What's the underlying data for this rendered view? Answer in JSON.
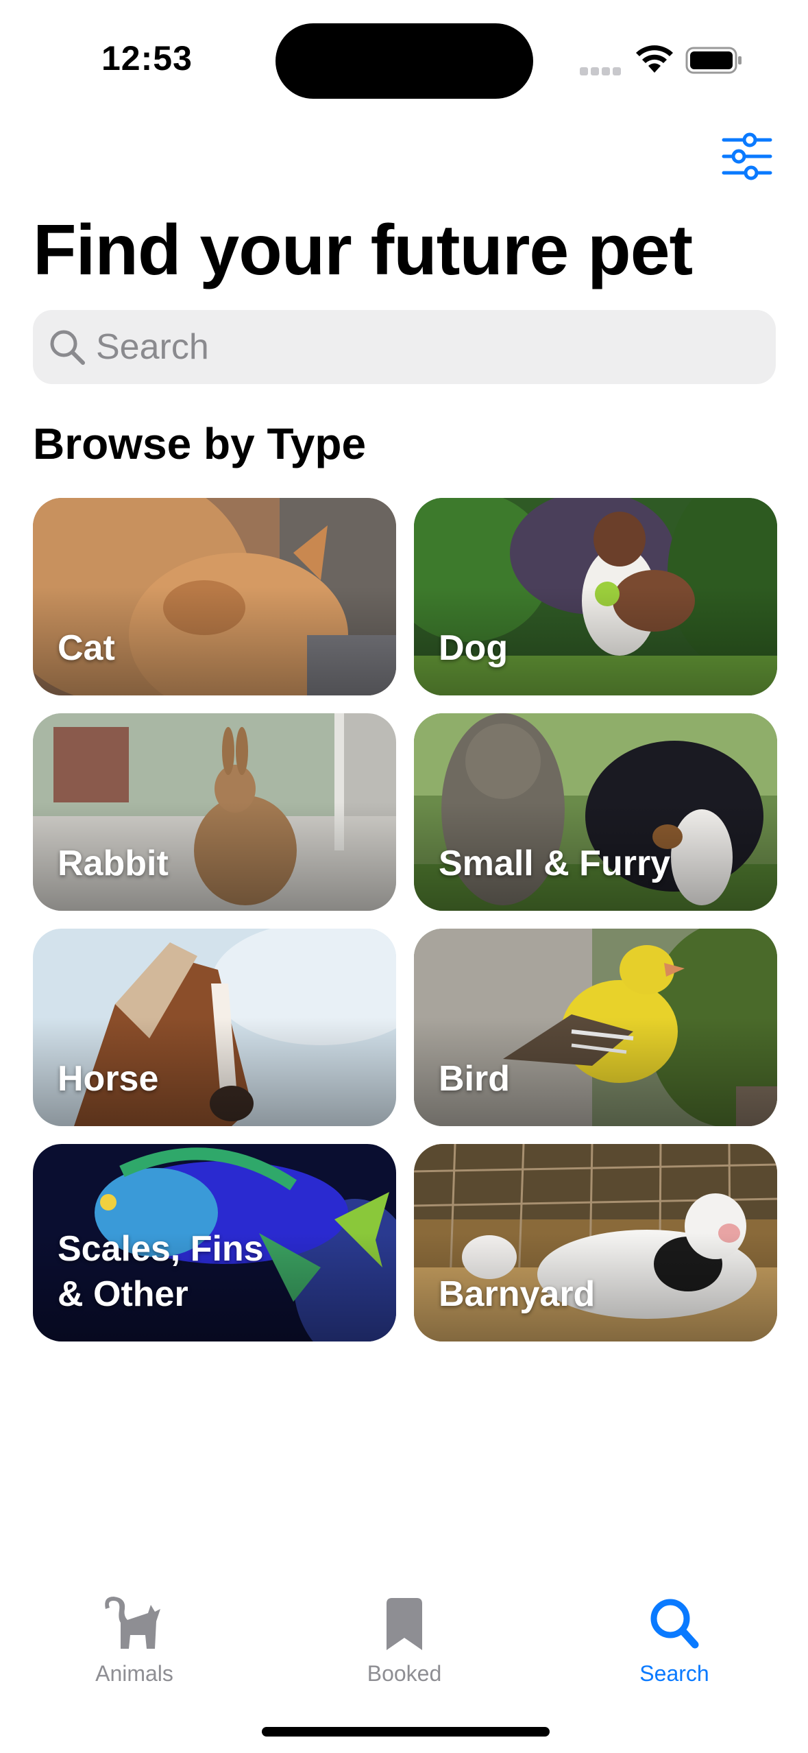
{
  "status": {
    "time": "12:53"
  },
  "header": {
    "title": "Find your future pet",
    "filter_icon": "sliders-icon"
  },
  "search": {
    "placeholder": "Search",
    "value": ""
  },
  "browse": {
    "title": "Browse by Type",
    "types": [
      {
        "label": "Cat"
      },
      {
        "label": "Dog"
      },
      {
        "label": "Rabbit"
      },
      {
        "label": "Small & Furry"
      },
      {
        "label": "Horse"
      },
      {
        "label": "Bird"
      },
      {
        "label": "Scales, Fins\n& Other"
      },
      {
        "label": "Barnyard"
      }
    ]
  },
  "tabbar": {
    "tabs": [
      {
        "label": "Animals",
        "icon": "cat-icon",
        "active": false
      },
      {
        "label": "Booked",
        "icon": "bookmark-icon",
        "active": false
      },
      {
        "label": "Search",
        "icon": "magnifier-icon",
        "active": true
      }
    ]
  },
  "colors": {
    "accent": "#0a7aff",
    "inactive": "#8e8e93",
    "search_bg": "#eeeeef"
  }
}
